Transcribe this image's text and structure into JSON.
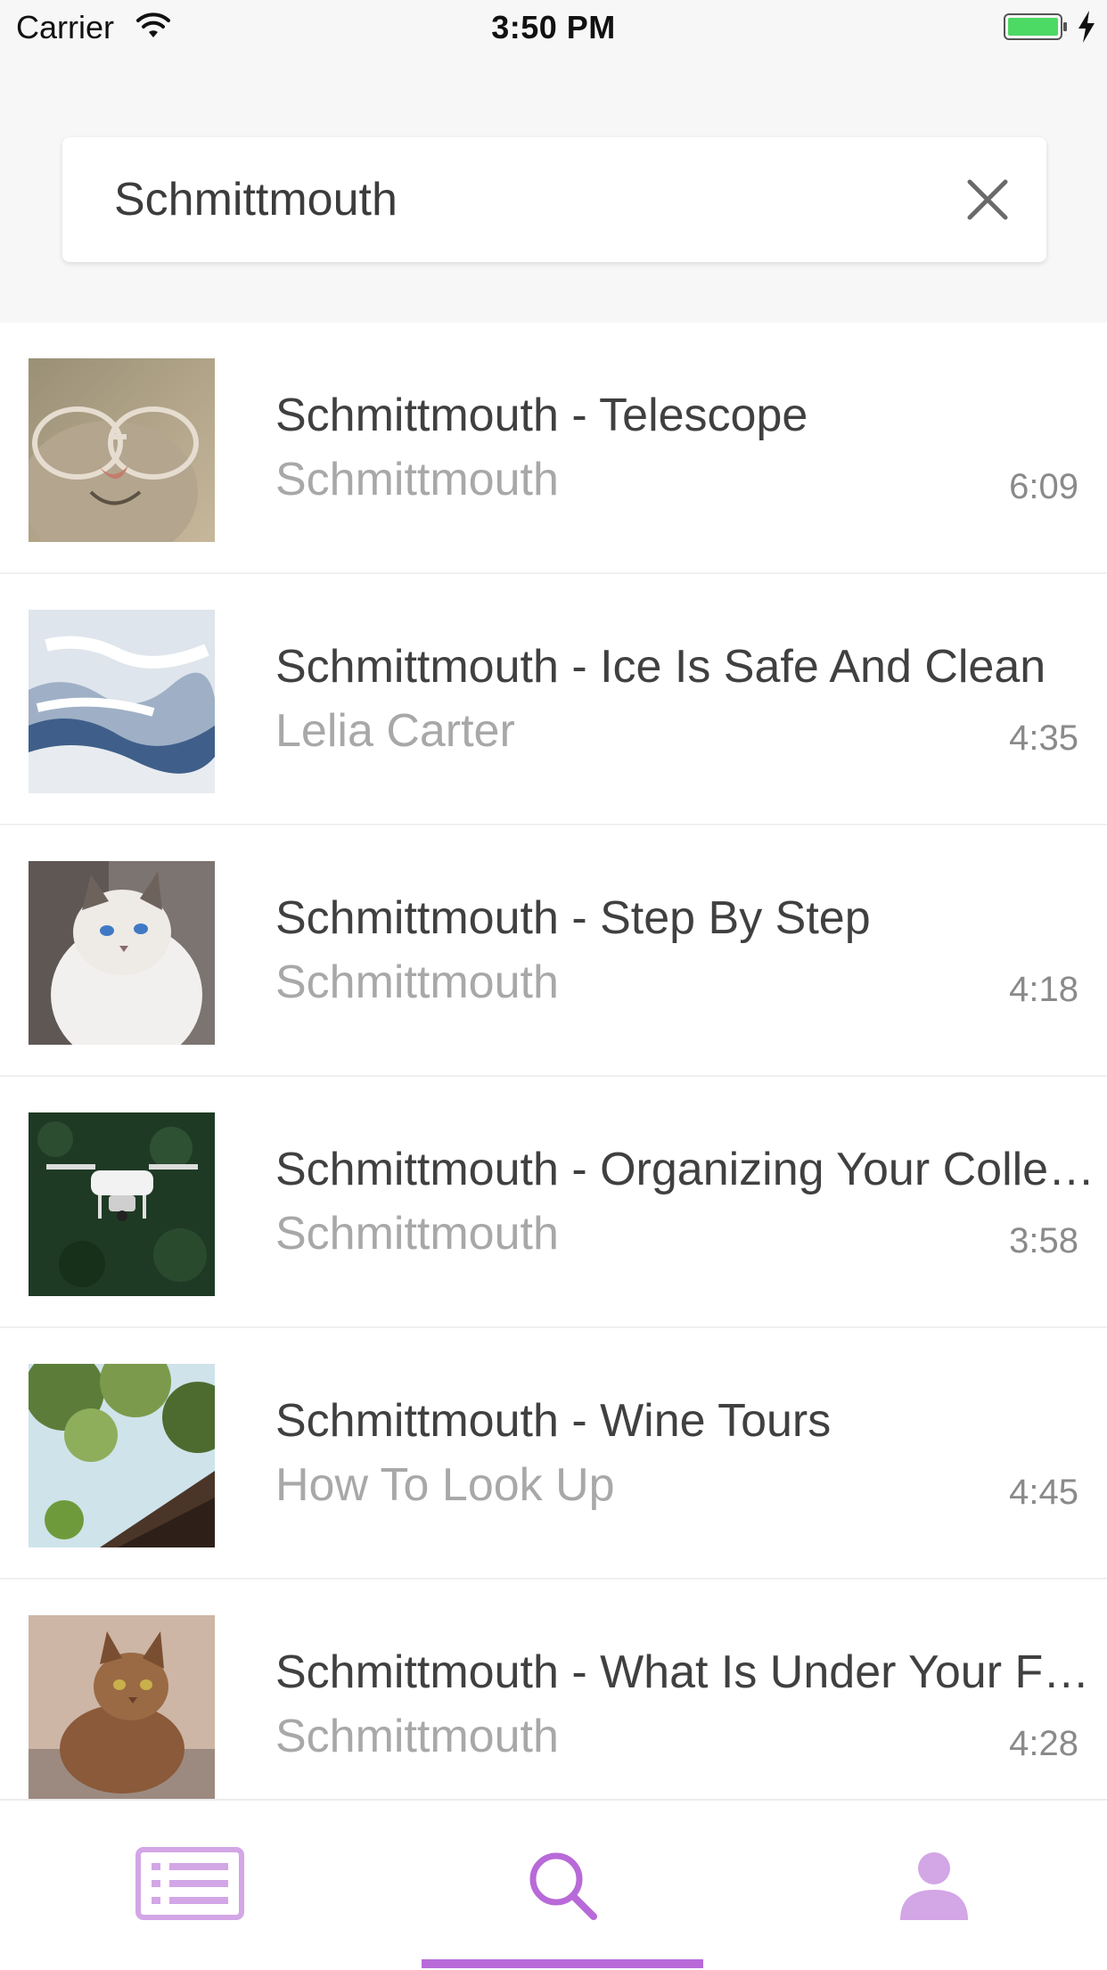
{
  "status_bar": {
    "carrier": "Carrier",
    "time": "3:50 PM",
    "wifi_icon": "wifi-icon",
    "battery_icon": "battery-charging-icon",
    "battery_color": "#4cd964"
  },
  "search": {
    "query": "Schmittmouth",
    "clear_icon": "close-icon"
  },
  "results": [
    {
      "title": "Schmittmouth - Telescope",
      "artist": "Schmittmouth",
      "duration": "6:09",
      "thumb": "cat-with-glasses"
    },
    {
      "title": "Schmittmouth - Ice Is Safe And Clean",
      "artist": "Lelia Carter",
      "duration": "4:35",
      "thumb": "snowy-mountains"
    },
    {
      "title": "Schmittmouth - Step By Step",
      "artist": "Schmittmouth",
      "duration": "4:18",
      "thumb": "white-cat"
    },
    {
      "title": "Schmittmouth - Organizing Your Collection",
      "artist": "Schmittmouth",
      "duration": "3:58",
      "thumb": "drone-over-forest"
    },
    {
      "title": "Schmittmouth - Wine Tours",
      "artist": "How To Look Up",
      "duration": "4:45",
      "thumb": "tree-canopy"
    },
    {
      "title": "Schmittmouth - What Is Under Your Feet",
      "artist": "Schmittmouth",
      "duration": "4:28",
      "thumb": "tabby-cat"
    }
  ],
  "tab_bar": {
    "tabs": [
      {
        "icon": "list-icon",
        "active": false
      },
      {
        "icon": "search-icon",
        "active": true
      },
      {
        "icon": "profile-icon",
        "active": false
      }
    ],
    "accent_color": "#b86ad8",
    "inactive_color": "#d3a6e6"
  }
}
